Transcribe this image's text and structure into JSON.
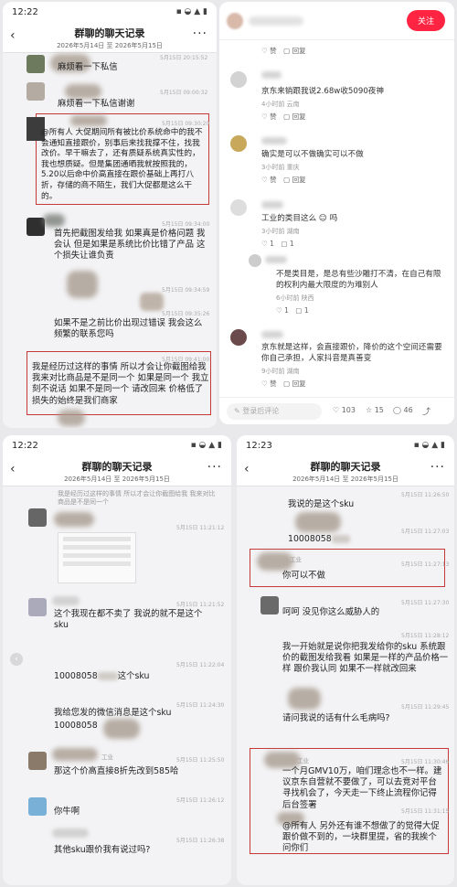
{
  "top_left": {
    "time": "12:22",
    "title": "群聊的聊天记录",
    "range": "2026年5月14日 至 2026年5月15日",
    "messages": [
      {
        "ts": "5月15日 20:15:52",
        "text": "麻烦看一下私信"
      },
      {
        "ts": "5月15日 09:00:32",
        "text": "麻烦看一下私信谢谢"
      },
      {
        "ts": "5月15日 09:30:20",
        "text": "@所有人 大促期间所有被比价系统命中的我不会通知直接跟价，别事后来找我撑不住，找我改价。早干嘛去了，还有质疑系统真实性的，我也想质疑。但是集团通晒我就按照我的，5.20以后命中价高直接在跟价基础上再打八折，存储的商不陌生，我们大促都是这么干的。"
      },
      {
        "ts": "5月15日 09:34:00",
        "text": "首先把截图发给我  如果真是价格问题 我会认  但是如果是系统比价比错了产品 这个损失让谁负责"
      },
      {
        "ts": "5月15日 09:34:59",
        "text": ""
      },
      {
        "ts": "5月15日 09:35:26",
        "text": "如果不是之前比价出现过错误  我会这么频繁的联系您吗"
      },
      {
        "ts": "5月15日 09:41:00",
        "text": "我是经历过这样的事情  所以才会让你截图给我  我来对比商品是不是同一个  如果是同一个 我立刻不说话  如果不是同一个  请改回来 价格低了  损失的始终是我们商家"
      }
    ]
  },
  "top_right": {
    "follow_label": "关注",
    "comments": [
      {
        "name": "",
        "text": "",
        "meta": "",
        "likes": "赞",
        "reply": "回复"
      },
      {
        "name": "",
        "text": "京东来销跟我说2.68w收5090夜神",
        "meta": "4小时前 云南",
        "likes": "赞",
        "reply": "回复"
      },
      {
        "name": "",
        "text": "确实是可以不做确实可以不做",
        "meta": "3小时前 重庆",
        "likes": "赞",
        "reply": "回复"
      },
      {
        "name": "",
        "text": "工业的类目这么",
        "meta": "3小时前 湖南",
        "likes": "1",
        "reply": "1"
      },
      {
        "name": "",
        "text": "不是类目是，是总有些沙雕打不清，在自己有限的权利内最大限度的为难别人",
        "meta": "6小时前 陕西",
        "likes": "1",
        "reply": "1"
      },
      {
        "name": "",
        "text": "京东就是这样，会直接跟价，降价的这个空间还需要你自己承担，人家抖音是真善变",
        "meta": "9小时前 湖南",
        "likes": "赞",
        "reply": "回复"
      }
    ],
    "bottom": {
      "placeholder": "登录后评论",
      "likes": "103",
      "stars": "15",
      "comments": "46"
    }
  },
  "bottom_left": {
    "time": "12:22",
    "title": "群聊的聊天记录",
    "range": "2026年5月14日 至 2026年5月15日",
    "messages": [
      {
        "ts": "5月15日 11:21:12",
        "text": "我是经历过这样的事情  所以才会让你截图给我  我来对比商品是不是同一个"
      },
      {
        "ts": "5月15日 11:21:52",
        "text": "这个我现在都不卖了  我说的就不是这个sku"
      },
      {
        "ts": "5月15日 11:22:04",
        "text": "10008058",
        "text2": "这个sku"
      },
      {
        "ts": "5月15日 11:24:30",
        "text": "我给您发的微信消息是这个sku",
        "text2": "10008058"
      },
      {
        "ts": "5月15日 11:25:50",
        "text": "那这个价高直接8折先改到585哈"
      },
      {
        "ts": "5月15日 11:26:12",
        "text": "你牛啊"
      },
      {
        "ts": "5月15日 11:26:38",
        "text": "其他sku跟价我有说过吗?"
      }
    ]
  },
  "bottom_right": {
    "time": "12:23",
    "title": "群聊的聊天记录",
    "range": "2026年5月14日 至 2026年5月15日",
    "messages": [
      {
        "ts": "5月15日 11:26:50",
        "text": "我说的是这个sku"
      },
      {
        "ts": "5月15日 11:27:03",
        "text": "10008058"
      },
      {
        "ts": "5月15日 11:27:13",
        "text": "你可以不做",
        "name": "工业"
      },
      {
        "ts": "5月15日 11:27:30",
        "text": "呵呵  没见你这么威胁人的"
      },
      {
        "ts": "5月15日 11:28:12",
        "text": "我一开始就是说你把我发给你的sku 系统跟价的截图发给我看  如果是一样的产品价格一样  跟价我认同  如果不一样就改回来"
      },
      {
        "ts": "5月15日 11:29:45",
        "text": "请问我说的话有什么毛病吗?"
      },
      {
        "ts": "5月15日 11:30:46",
        "text": "一个月GMV10万，咱们理念也不一样。建议京东自营就不要做了，可以去竞对平台寻找机会了，今天走一下终止流程你记得后台签署",
        "name": "工业"
      },
      {
        "ts": "5月15日 11:31:15",
        "text": "@所有人 另外还有谁不想做了的觉得大促跟价做不到的，一块群里提，省的我挨个问你们",
        "name": "工业"
      }
    ]
  }
}
